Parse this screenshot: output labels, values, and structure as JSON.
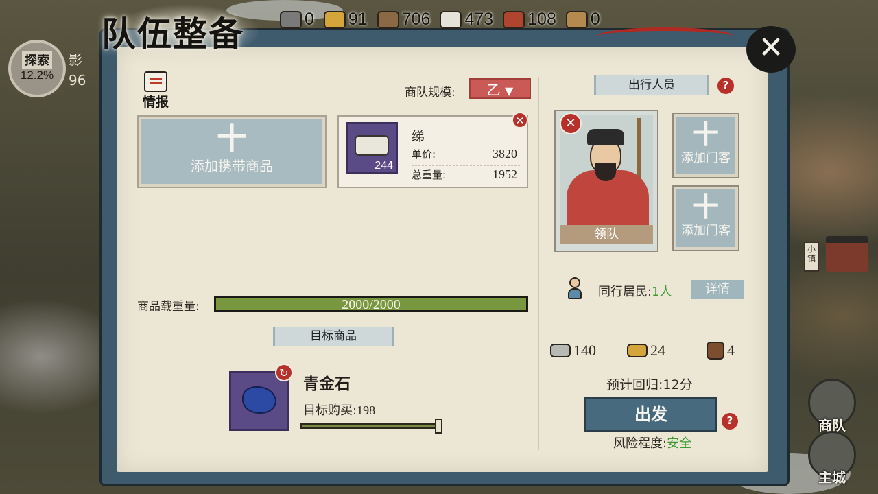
{
  "title": "队伍整备",
  "resources": [
    {
      "icon": "stone-icon",
      "value": "0",
      "color": "#7a7a78"
    },
    {
      "icon": "coins-icon",
      "value": "91",
      "color": "#d4a53b"
    },
    {
      "icon": "wood-plank-icon",
      "value": "706",
      "color": "#8a6a44"
    },
    {
      "icon": "silk-cloth-icon",
      "value": "473",
      "color": "#e5e2da"
    },
    {
      "icon": "leather-icon",
      "value": "108",
      "color": "#b0452f"
    },
    {
      "icon": "barrel-icon",
      "value": "0",
      "color": "#b58a4e"
    }
  ],
  "explore": {
    "label": "探索",
    "percent": "12.2%",
    "side_text": "影",
    "side_value": "96"
  },
  "intel_label": "情报",
  "caravan_scale": {
    "label": "商队规模:",
    "value": "乙"
  },
  "add_goods": {
    "plus": "十",
    "label": "添加携带商品"
  },
  "carried_goods": {
    "name": "绨",
    "quantity": "244",
    "unit_price_label": "单价:",
    "unit_price": "3820",
    "total_weight_label": "总重量:",
    "total_weight": "1952"
  },
  "load": {
    "label": "商品载重量:",
    "text": "2000/2000",
    "fraction": 1.0
  },
  "target_section": "目标商品",
  "target_goods": {
    "name": "青金石",
    "buy_label": "目标购买:",
    "buy_value": "198",
    "slider_fraction": 1.0
  },
  "personnel_section": "出行人员",
  "leader_label": "领队",
  "add_guest_label": "添加门客",
  "add_guest_plus": "十",
  "residents": {
    "label": "同行居民:",
    "value": "1人",
    "detail_button": "详情"
  },
  "costs": [
    {
      "icon": "silver-ingot-icon",
      "value": "140",
      "color": "#b8b8b4"
    },
    {
      "icon": "coins-icon",
      "value": "24",
      "color": "#d4a53b"
    },
    {
      "icon": "horse-icon",
      "value": "4",
      "color": "#7a4e2e"
    }
  ],
  "eta": "预计回归:12分",
  "depart_button": "出发",
  "risk": {
    "label": "风险程度:",
    "value": "安全"
  },
  "side_nav": {
    "caravan": "商队",
    "main_city": "主城",
    "town": "小镇"
  },
  "help_glyph": "?",
  "remove_glyph": "✕",
  "close_glyph": "✕",
  "refresh_glyph": "↻",
  "dropdown_arrow": "▼"
}
